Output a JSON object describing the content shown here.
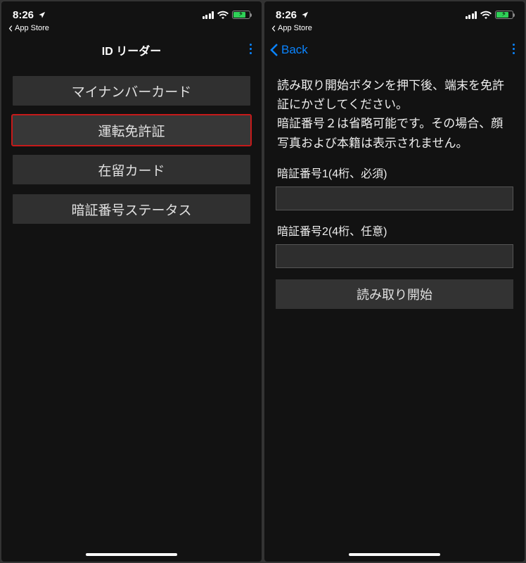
{
  "status": {
    "time": "8:26",
    "back_context": "App Store"
  },
  "left": {
    "title": "ID リーダー",
    "buttons": [
      {
        "label": "マイナンバーカード",
        "selected": false
      },
      {
        "label": "運転免許証",
        "selected": true
      },
      {
        "label": "在留カード",
        "selected": false
      },
      {
        "label": "暗証番号ステータス",
        "selected": false
      }
    ]
  },
  "right": {
    "back_label": "Back",
    "instruction": "読み取り開始ボタンを押下後、端末を免許証にかざしてください。\n暗証番号２は省略可能です。その場合、顔写真および本籍は表示されません。",
    "pin1_label": "暗証番号1(4桁、必須)",
    "pin2_label": "暗証番号2(4桁、任意)",
    "start_label": "読み取り開始"
  }
}
